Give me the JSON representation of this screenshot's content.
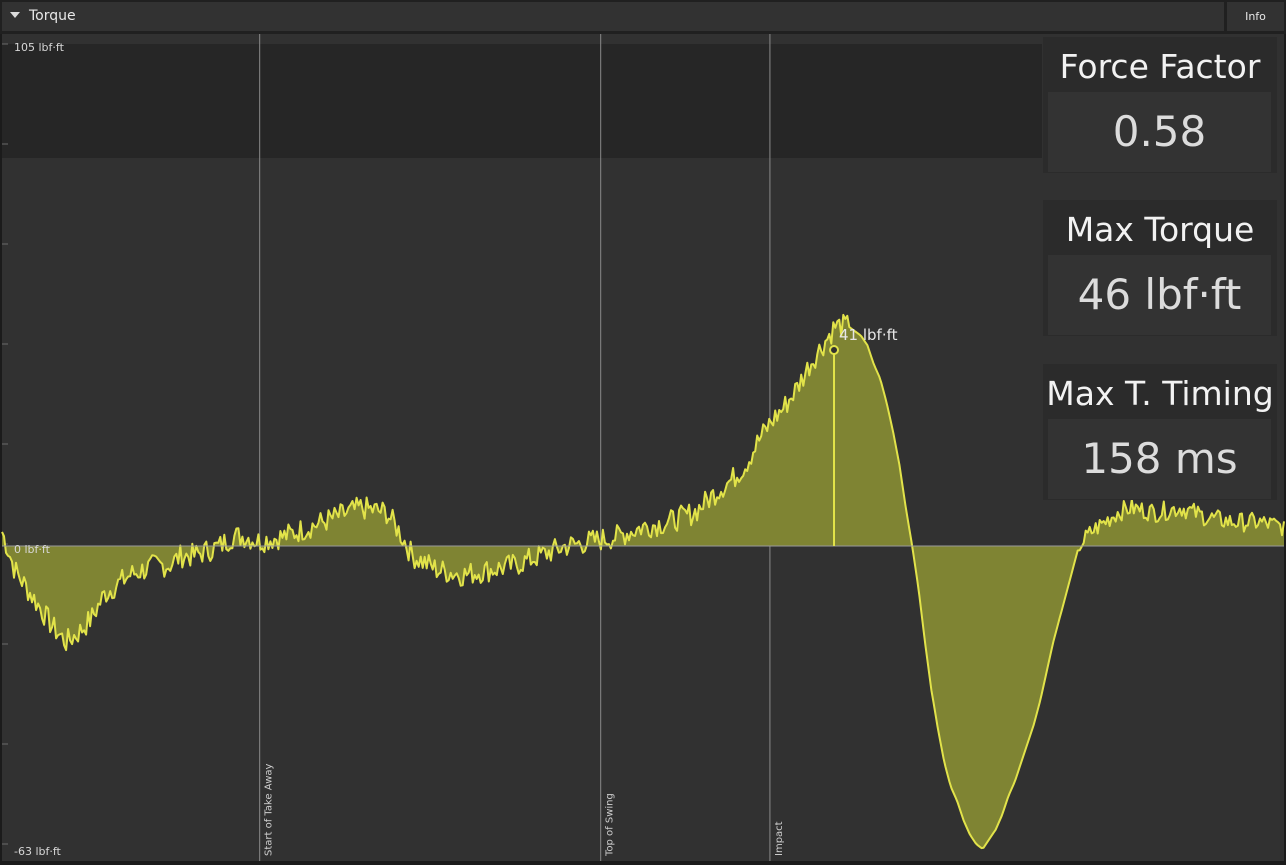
{
  "panel": {
    "title": "Torque",
    "info_label": "Info"
  },
  "stats": [
    {
      "label": "Force Factor",
      "value": "0.58"
    },
    {
      "label": "Max Torque",
      "value": "46 lbf·ft"
    },
    {
      "label": "Max T. Timing",
      "value": "158 ms"
    }
  ],
  "colors": {
    "fill": "#7f8433",
    "line": "#e2e34a",
    "background": "#313131",
    "band": "#262626"
  },
  "chart_data": {
    "type": "area",
    "ylim": [
      -63,
      105
    ],
    "y_axis_labels": {
      "top": "105 lbf·ft",
      "zero": "0 lbf·ft",
      "bottom": "-63 lbf·ft"
    },
    "x_range": [
      0,
      100
    ],
    "markers": [
      {
        "label": "Start of Take Away",
        "x": 20.1
      },
      {
        "label": "Top of Swing",
        "x": 46.7
      },
      {
        "label": "Impact",
        "x": 59.9
      }
    ],
    "annotation": {
      "label": "41 lbf·ft",
      "x": 64.9,
      "y": 41
    },
    "series": [
      {
        "x": [
          0,
          1,
          2,
          3,
          4,
          5,
          6,
          7,
          8,
          9,
          10,
          11,
          12,
          13,
          14,
          15,
          16,
          17,
          18,
          19,
          20,
          22,
          24,
          26,
          28,
          30,
          31,
          32,
          34,
          36,
          38,
          40,
          42,
          44,
          46,
          48,
          50,
          52,
          54,
          56,
          57,
          58,
          59,
          60,
          61,
          62,
          63,
          64,
          65,
          66,
          67,
          67.5,
          68,
          68.5,
          69,
          69.5,
          70,
          70.5,
          71,
          71.5,
          72,
          72.5,
          73,
          73.5,
          74,
          74.5,
          75,
          75.5,
          76,
          76.5,
          77,
          77.5,
          78,
          78.5,
          79,
          79.5,
          80,
          80.5,
          81,
          81.5,
          82,
          82.5,
          83,
          83.5,
          84,
          85,
          86,
          87,
          88,
          90,
          92,
          94,
          96,
          98,
          100
        ],
        "y": [
          3,
          -5,
          -9,
          -13,
          -17,
          -20,
          -18,
          -15,
          -10,
          -8,
          -6,
          -5,
          -4,
          -4,
          -2,
          -2,
          -1,
          0,
          2,
          2,
          1,
          2,
          4,
          6,
          8,
          7,
          3,
          -2,
          -5,
          -6,
          -5,
          -4,
          -2,
          0,
          1,
          2,
          4,
          5,
          7,
          12,
          14,
          17,
          22,
          26,
          29,
          33,
          38,
          42,
          46,
          46,
          44,
          42,
          38,
          35,
          30,
          24,
          17,
          8,
          0,
          -9,
          -20,
          -30,
          -38,
          -45,
          -50,
          -53,
          -57,
          -60,
          -62,
          -63,
          -61,
          -59,
          -56,
          -52,
          -49,
          -45,
          -41,
          -37,
          -32,
          -26,
          -20,
          -15,
          -10,
          -5,
          0,
          3,
          5,
          7,
          8,
          7,
          8,
          6,
          5,
          5,
          4
        ]
      }
    ]
  }
}
